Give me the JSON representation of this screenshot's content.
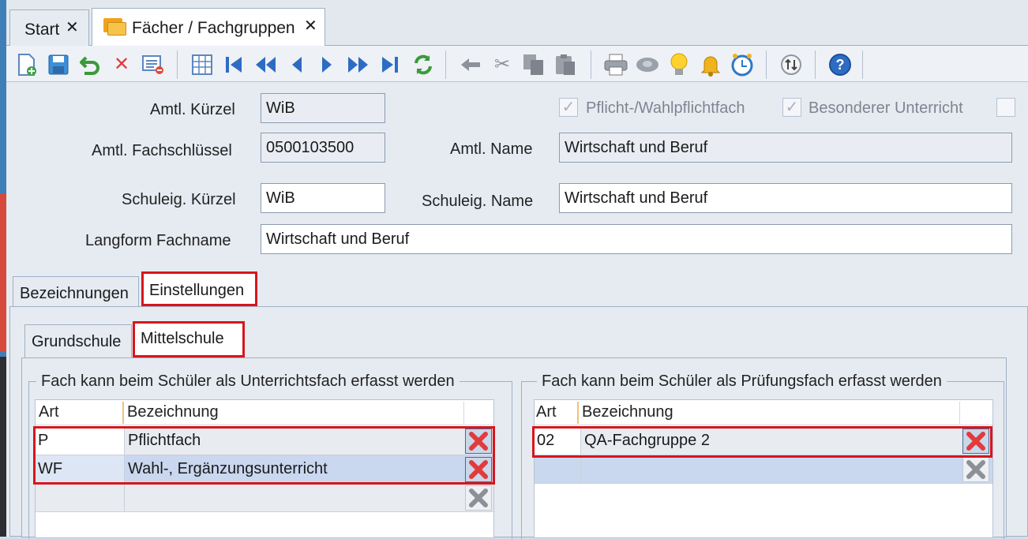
{
  "tabs": {
    "start": "Start",
    "faecher": "Fächer / Fachgruppen",
    "close_glyph": "✕"
  },
  "form": {
    "amtl_kuerzel_label": "Amtl. Kürzel",
    "amtl_kuerzel_value": "WiB",
    "amtl_fachschluessel_label": "Amtl.  Fachschlüssel",
    "amtl_fachschluessel_value": "0500103500",
    "amtl_name_label": "Amtl. Name",
    "amtl_name_value": "Wirtschaft und Beruf",
    "schuleig_kuerzel_label": "Schuleig. Kürzel",
    "schuleig_kuerzel_value": "WiB",
    "schuleig_name_label": "Schuleig. Name",
    "schuleig_name_value": "Wirtschaft und Beruf",
    "langform_label": "Langform Fachname",
    "langform_value": "Wirtschaft und Beruf",
    "pflicht_label": "Pflicht-/Wahlpflichtfach",
    "besonderer_label": "Besonderer Unterricht"
  },
  "main_tabs": {
    "bezeichnungen": "Bezeichnungen",
    "einstellungen": "Einstellungen"
  },
  "sub_tabs": {
    "grundschule": "Grundschule",
    "mittelschule": "Mittelschule"
  },
  "unterricht": {
    "title": "Fach kann beim Schüler als Unterrichtsfach erfasst werden",
    "col_art": "Art",
    "col_bez": "Bezeichnung",
    "rows": [
      {
        "art": "P",
        "bez": "Pflichtfach"
      },
      {
        "art": "WF",
        "bez": "Wahl-, Ergänzungsunterricht"
      }
    ]
  },
  "pruefung": {
    "title": "Fach kann beim Schüler als Prüfungsfach erfasst werden",
    "col_art": "Art",
    "col_bez": "Bezeichnung",
    "rows": [
      {
        "art": "02",
        "bez": "QA-Fachgruppe 2"
      }
    ]
  },
  "colors": {
    "highlight": "#d8161c",
    "delete_red": "#e23b3b",
    "selected_row": "#c9d7ef"
  }
}
